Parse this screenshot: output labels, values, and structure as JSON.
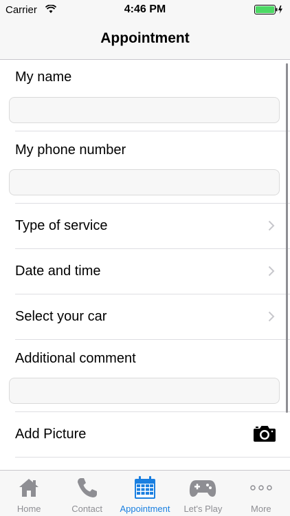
{
  "status_bar": {
    "carrier": "Carrier",
    "time": "4:46 PM"
  },
  "nav": {
    "title": "Appointment"
  },
  "form": {
    "name_label": "My name",
    "name_value": "",
    "phone_label": "My phone number",
    "phone_value": "",
    "service_label": "Type of service",
    "datetime_label": "Date and time",
    "car_label": "Select your car",
    "comment_label": "Additional comment",
    "comment_value": "",
    "picture_label": "Add Picture"
  },
  "tabs": [
    {
      "label": "Home",
      "icon": "home-icon",
      "active": false
    },
    {
      "label": "Contact",
      "icon": "phone-icon",
      "active": false
    },
    {
      "label": "Appointment",
      "icon": "calendar-icon",
      "active": true
    },
    {
      "label": "Let's Play",
      "icon": "gamepad-icon",
      "active": false
    },
    {
      "label": "More",
      "icon": "more-icon",
      "active": false
    }
  ],
  "colors": {
    "accent": "#1a7fe0",
    "inactive": "#8e8e93",
    "battery": "#4cd964"
  }
}
